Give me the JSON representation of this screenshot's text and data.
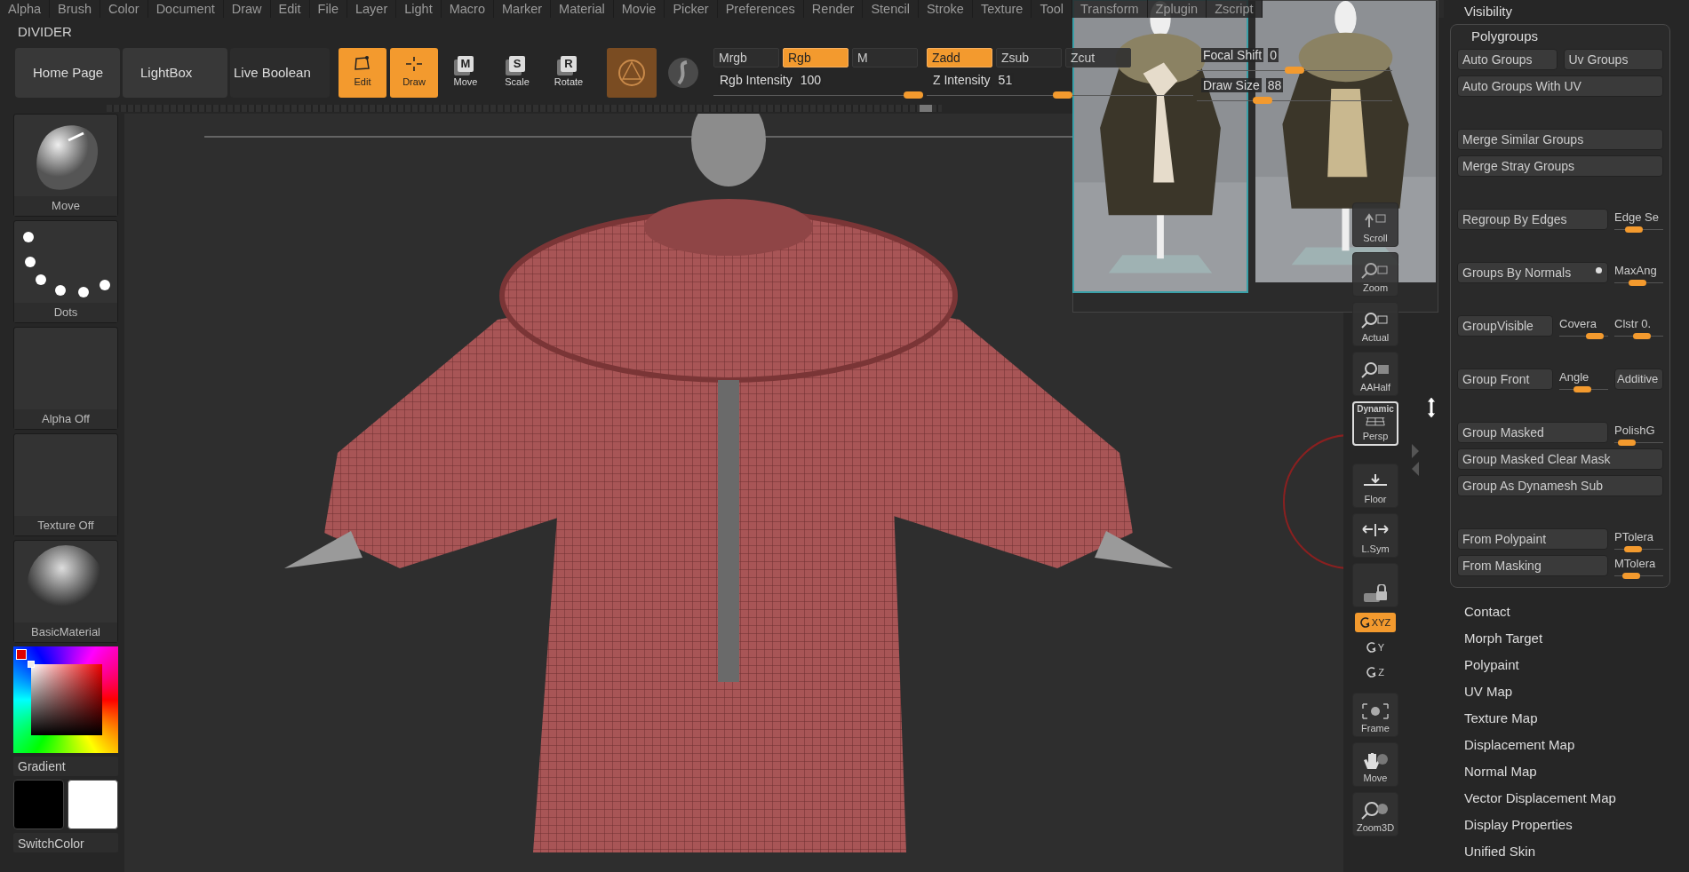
{
  "menu": [
    "Alpha",
    "Brush",
    "Color",
    "Document",
    "Draw",
    "Edit",
    "File",
    "Layer",
    "Light",
    "Macro",
    "Marker",
    "Material",
    "Movie",
    "Picker",
    "Preferences",
    "Render",
    "Stencil",
    "Stroke",
    "Texture",
    "Tool",
    "Transform",
    "Zplugin",
    "Zscript"
  ],
  "palette_title": "DIVIDER",
  "shelf": [
    {
      "label": "Home Page",
      "kind": "page"
    },
    {
      "label": "LightBox",
      "kind": "page"
    },
    {
      "label": "Live Boolean",
      "kind": "toggle"
    }
  ],
  "tools": [
    {
      "label": "Edit",
      "kind": "edit",
      "selected": true
    },
    {
      "label": "Draw",
      "kind": "draw",
      "selected": true
    },
    {
      "label": "Move",
      "kind": "letter",
      "letter": "M",
      "selected": false
    },
    {
      "label": "Scale",
      "kind": "letter",
      "letter": "S",
      "selected": false
    },
    {
      "label": "Rotate",
      "kind": "letter",
      "letter": "R",
      "selected": false
    }
  ],
  "color_modes": [
    {
      "label": "Mrgb",
      "selected": false
    },
    {
      "label": "Rgb",
      "selected": true
    },
    {
      "label": "M",
      "selected": false
    }
  ],
  "depth_modes": [
    {
      "label": "Zadd",
      "selected": true
    },
    {
      "label": "Zsub",
      "selected": false
    },
    {
      "label": "Zcut",
      "selected": false
    }
  ],
  "sliders": [
    {
      "label": "Rgb Intensity",
      "reading": "100",
      "level": 1
    },
    {
      "label": "Z Intensity",
      "reading": "51",
      "level": 0.51
    },
    {
      "label": "Focal Shift",
      "reading": "0",
      "level": 0.5
    },
    {
      "label": "Draw Size",
      "reading": "88",
      "level": 0.32
    }
  ],
  "left_tiles": [
    {
      "label": "Move",
      "kind": "brush"
    },
    {
      "label": "Dots",
      "kind": "stroke"
    },
    {
      "label": "Alpha Off",
      "kind": "alpha"
    },
    {
      "label": "Texture Off",
      "kind": "texture"
    },
    {
      "label": "BasicMaterial",
      "kind": "material"
    }
  ],
  "gradient_label": "Gradient",
  "swatches": [
    {
      "color": "#000000"
    },
    {
      "color": "#ffffff"
    }
  ],
  "switch_color_label": "SwitchColor",
  "reference_images": [
    {
      "selected": true
    },
    {
      "selected": false
    }
  ],
  "view_buttons": [
    {
      "label": "Scroll",
      "kind": "scroll"
    },
    {
      "label": "Zoom",
      "kind": "zoom"
    },
    {
      "label": "Actual",
      "kind": "actual"
    },
    {
      "label": "AAHalf",
      "kind": "aahalf"
    },
    {
      "label": "Persp",
      "caption": "Dynamic",
      "kind": "persp",
      "highlighted": true
    },
    {
      "label": "Floor",
      "kind": "floor"
    },
    {
      "label": "L.Sym",
      "kind": "lsym"
    },
    {
      "kind": "lock"
    },
    {
      "label": "XYZ",
      "kind": "rotate",
      "selected": true
    },
    {
      "label": "Y",
      "kind": "rotate",
      "selected": false
    },
    {
      "label": "Z",
      "kind": "rotate",
      "selected": false
    },
    {
      "label": "Frame",
      "kind": "frame"
    },
    {
      "label": "Move",
      "kind": "pan"
    },
    {
      "label": "Zoom3D",
      "kind": "zoom3d"
    }
  ],
  "tool_panel": {
    "collapsed_header": "Visibility",
    "polygroups": {
      "title": "Polygroups",
      "groups": [
        [
          [
            {
              "kind": "button",
              "label": "Auto Groups"
            },
            {
              "kind": "button",
              "label": "Uv Groups"
            }
          ],
          [
            {
              "kind": "button",
              "label": "Auto Groups With UV"
            }
          ]
        ],
        [
          [
            {
              "kind": "button",
              "label": "Merge Similar Groups"
            }
          ],
          [
            {
              "kind": "button",
              "label": "Merge Stray Groups"
            }
          ]
        ],
        [
          [
            {
              "kind": "button",
              "label": "Regroup By Edges"
            },
            {
              "kind": "slider",
              "label": "Edge Se",
              "level": 0.35
            }
          ]
        ],
        [
          [
            {
              "kind": "button",
              "label": "Groups By Normals",
              "dot": true
            },
            {
              "kind": "slider",
              "label": "MaxAng",
              "level": 0.45
            }
          ]
        ],
        [
          [
            {
              "kind": "button",
              "label": "GroupVisible"
            },
            {
              "kind": "slider",
              "label": "Covera",
              "level": 0.85
            },
            {
              "kind": "slider",
              "label": "Clstr 0.",
              "level": 0.6
            }
          ]
        ],
        [
          [
            {
              "kind": "button",
              "label": "Group Front"
            },
            {
              "kind": "slider",
              "label": "Angle",
              "level": 0.45
            },
            {
              "kind": "mini_button",
              "label": "Additive"
            }
          ]
        ],
        [
          [
            {
              "kind": "button",
              "label": "Group Masked"
            },
            {
              "kind": "slider",
              "label": "PolishG",
              "level": 0.1
            }
          ],
          [
            {
              "kind": "button",
              "label": "Group Masked Clear Mask"
            }
          ],
          [
            {
              "kind": "button",
              "label": "Group As Dynamesh Sub"
            }
          ]
        ],
        [
          [
            {
              "kind": "button",
              "label": "From Polypaint"
            },
            {
              "kind": "slider",
              "label": "PTolera",
              "level": 0.3
            }
          ],
          [
            {
              "kind": "button",
              "label": "From Masking"
            },
            {
              "kind": "slider",
              "label": "MTolera",
              "level": 0.25
            }
          ]
        ]
      ]
    },
    "subpalettes": [
      "Contact",
      "Morph Target",
      "Polypaint",
      "UV Map",
      "Texture Map",
      "Displacement Map",
      "Normal Map",
      "Vector Displacement Map",
      "Display Properties",
      "Unified Skin"
    ]
  }
}
